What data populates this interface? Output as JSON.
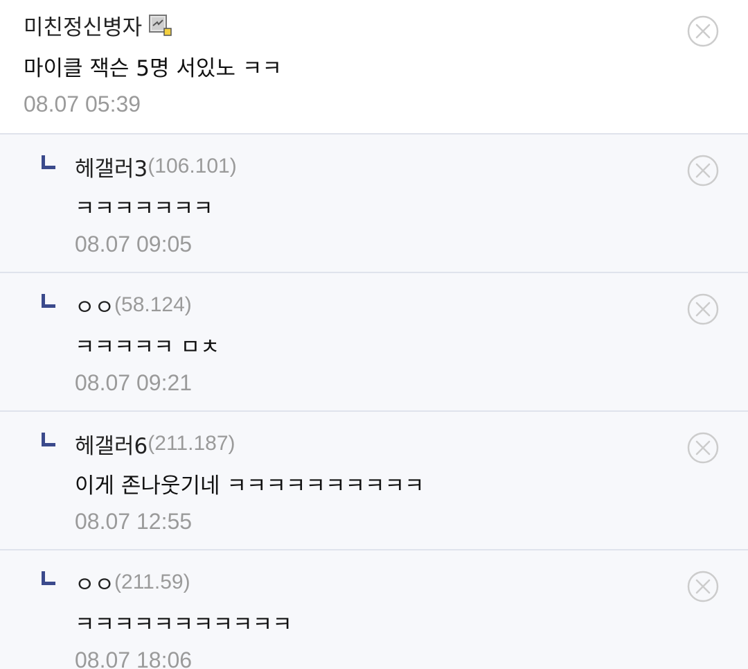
{
  "comments": [
    {
      "author": "미친정신병자",
      "ip": "",
      "body": "마이클 잭슨 5명 서있노 ㅋㅋ",
      "time": "08.07 05:39"
    },
    {
      "author": "헤갤러3",
      "ip": "(106.101)",
      "body": "ㅋㅋㅋㅋㅋㅋㅋ",
      "time": "08.07 09:05"
    },
    {
      "author": "ㅇㅇ",
      "ip": "(58.124)",
      "body": "ㅋㅋㅋㅋㅋ ㅁㅊ",
      "time": "08.07 09:21"
    },
    {
      "author": "헤갤러6",
      "ip": "(211.187)",
      "body": "이게 존나웃기네 ㅋㅋㅋㅋㅋㅋㅋㅋㅋㅋ",
      "time": "08.07 12:55"
    },
    {
      "author": "ㅇㅇ",
      "ip": "(211.59)",
      "body": "ㅋㅋㅋㅋㅋㅋㅋㅋㅋㅋㅋ",
      "time": "08.07 18:06"
    }
  ],
  "icons": {
    "member": "member-memo-icon",
    "reply": "reply-arrow-icon",
    "delete": "circle-x-icon"
  },
  "colors": {
    "reply_bg": "#f7f8fb",
    "reply_arrow": "#3b4a8c",
    "meta_gray": "#9a9a9a"
  }
}
